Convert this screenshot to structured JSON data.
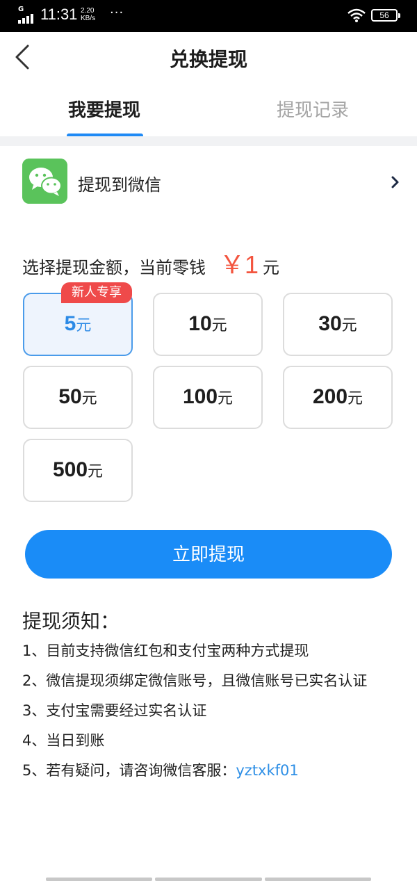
{
  "status_bar": {
    "time": "11:31",
    "network_type": "G",
    "speed_value": "2.20",
    "speed_unit": "KB/s",
    "more": "···",
    "battery": "56"
  },
  "nav": {
    "title": "兑换提现",
    "back_icon": "chevron-left-icon"
  },
  "tabs": [
    {
      "label": "我要提现",
      "active": true
    },
    {
      "label": "提现记录",
      "active": false
    }
  ],
  "withdraw_target": {
    "label": "提现到微信",
    "icon": "wechat-icon",
    "icon_color": "#5ac35b"
  },
  "amount_header": {
    "label": "选择提现金额，当前零钱",
    "balance": "￥1",
    "unit": "元"
  },
  "badge": "新人专享",
  "amounts": [
    {
      "value": "5",
      "unit": "元",
      "selected": true
    },
    {
      "value": "10",
      "unit": "元",
      "selected": false
    },
    {
      "value": "30",
      "unit": "元",
      "selected": false
    },
    {
      "value": "50",
      "unit": "元",
      "selected": false
    },
    {
      "value": "100",
      "unit": "元",
      "selected": false
    },
    {
      "value": "200",
      "unit": "元",
      "selected": false
    },
    {
      "value": "500",
      "unit": "元",
      "selected": false
    }
  ],
  "withdraw_button": "立即提现",
  "notice": {
    "title": "提现须知：",
    "items": [
      "1、目前支持微信红包和支付宝两种方式提现",
      "2、微信提现须绑定微信账号，且微信账号已实名认证",
      "3、支付宝需要经过实名认证",
      "4、当日到账",
      "5、若有疑问，请咨询微信客服："
    ],
    "service_id": "yztxkf01"
  },
  "colors": {
    "accent": "#1a8cf7",
    "balance_red": "#f3553f",
    "badge_red": "#ef4a4a",
    "link_blue": "#2e8fe6"
  }
}
